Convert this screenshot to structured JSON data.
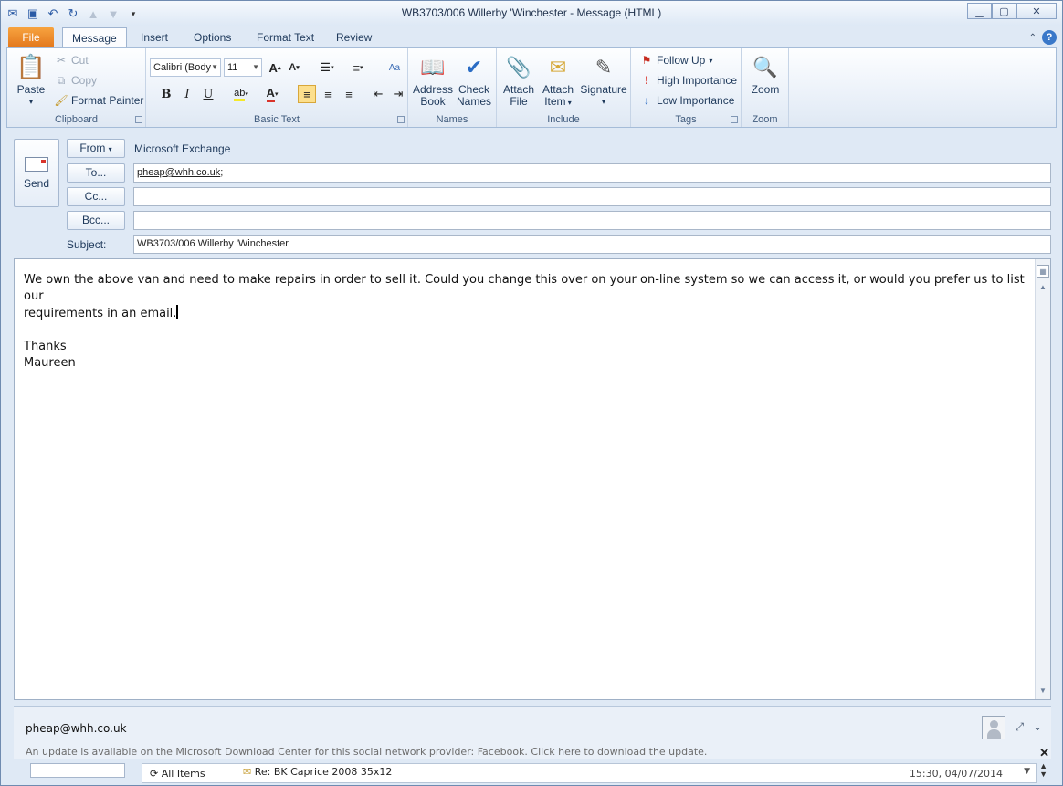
{
  "window": {
    "title": "WB3703/006 Willerby 'Winchester  -  Message (HTML)"
  },
  "tabs": [
    {
      "label": "File"
    },
    {
      "label": "Message"
    },
    {
      "label": "Insert"
    },
    {
      "label": "Options"
    },
    {
      "label": "Format Text"
    },
    {
      "label": "Review"
    }
  ],
  "ribbon": {
    "clipboard": {
      "group_label": "Clipboard",
      "paste": "Paste",
      "cut": "Cut",
      "copy": "Copy",
      "format_painter": "Format Painter"
    },
    "basic_text": {
      "group_label": "Basic Text",
      "font_name": "Calibri (Body)",
      "font_size": "11",
      "bold": "B",
      "italic": "I",
      "underline": "U"
    },
    "names": {
      "group_label": "Names",
      "address_book_1": "Address",
      "address_book_2": "Book",
      "check_names_1": "Check",
      "check_names_2": "Names"
    },
    "include": {
      "group_label": "Include",
      "attach_file_1": "Attach",
      "attach_file_2": "File",
      "attach_item_1": "Attach",
      "attach_item_2": "Item",
      "signature": "Signature"
    },
    "tags": {
      "group_label": "Tags",
      "follow_up": "Follow Up",
      "high_importance": "High Importance",
      "low_importance": "Low Importance"
    },
    "zoom": {
      "group_label": "Zoom",
      "zoom": "Zoom"
    }
  },
  "header": {
    "send": "Send",
    "from_label": "From",
    "from_value": "Microsoft Exchange",
    "to_label": "To...",
    "to_value": "pheap@whh.co.uk",
    "to_suffix": ";",
    "cc_label": "Cc...",
    "cc_value": "",
    "bcc_label": "Bcc...",
    "bcc_value": "",
    "subject_label": "Subject:",
    "subject_value": "WB3703/006 Willerby 'Winchester"
  },
  "body": {
    "line1": "We own the above van and need to make repairs in order to sell it.  Could you change this over on your on-line system so we can access it, or would you prefer us to list our",
    "line2": "requirements in an email.",
    "line3": "",
    "line4": "Thanks",
    "line5": "Maureen"
  },
  "people_pane": {
    "name": "pheap@whh.co.uk",
    "update_notice": "An update is available on the Microsoft Download Center for this social network provider: Facebook. Click here to download the update."
  },
  "feed": {
    "filter": "All Items",
    "item_title": "Re: BK Caprice 2008 35x12",
    "item_time": "15:30, 04/07/2014"
  },
  "colors": {
    "file_tab": "#e2761b",
    "ribbon_bg": "#e8eff8",
    "selected_align": "#fcdf8d",
    "high_importance": "#d9342b",
    "low_importance": "#2a6cc4"
  }
}
